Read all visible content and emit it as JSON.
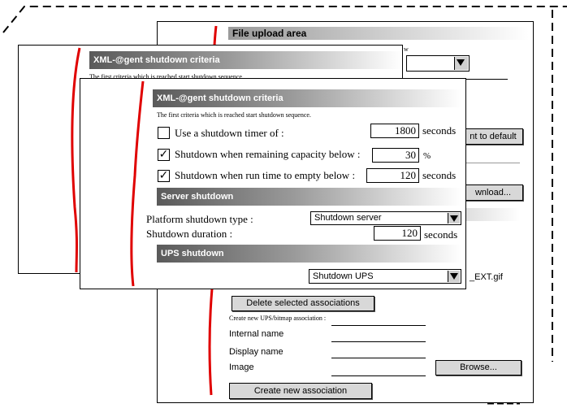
{
  "back_panel": {
    "title": "File upload area",
    "partial_w": "w",
    "reset_btn": "nt to default",
    "download_btn": "wnload...",
    "ext_file": "_EXT.gif",
    "delete_btn": "Delete selected associations",
    "create_hint": "Create new UPS/bitmap association :",
    "internal_name_label": "Internal name",
    "display_name_label": "Display name",
    "image_label": "Image",
    "browse_btn": "Browse...",
    "create_btn": "Create new association"
  },
  "middle_panel": {
    "title": "XML-@gent shutdown criteria",
    "subtitle": "The first criteria which is reached start shutdown sequence."
  },
  "front_panel": {
    "title": "XML-@gent shutdown criteria",
    "subtitle": "The first criteria which is reached start shutdown sequence.",
    "timer_label": "Use a shutdown timer of :",
    "timer_value": "1800",
    "timer_unit": "seconds",
    "capacity_label": "Shutdown when remaining capacity below :",
    "capacity_value": "30",
    "capacity_unit": "%",
    "runtime_label": "Shutdown when run time to empty below :",
    "runtime_value": "120",
    "runtime_unit": "seconds",
    "server_section": "Server shutdown",
    "platform_label": "Platform shutdown type :",
    "platform_value": "Shutdown server",
    "duration_label": "Shutdown duration :",
    "duration_value": "120",
    "duration_unit": "seconds",
    "ups_section": "UPS shutdown",
    "ups_value": "Shutdown UPS"
  },
  "check_mark": "✓"
}
